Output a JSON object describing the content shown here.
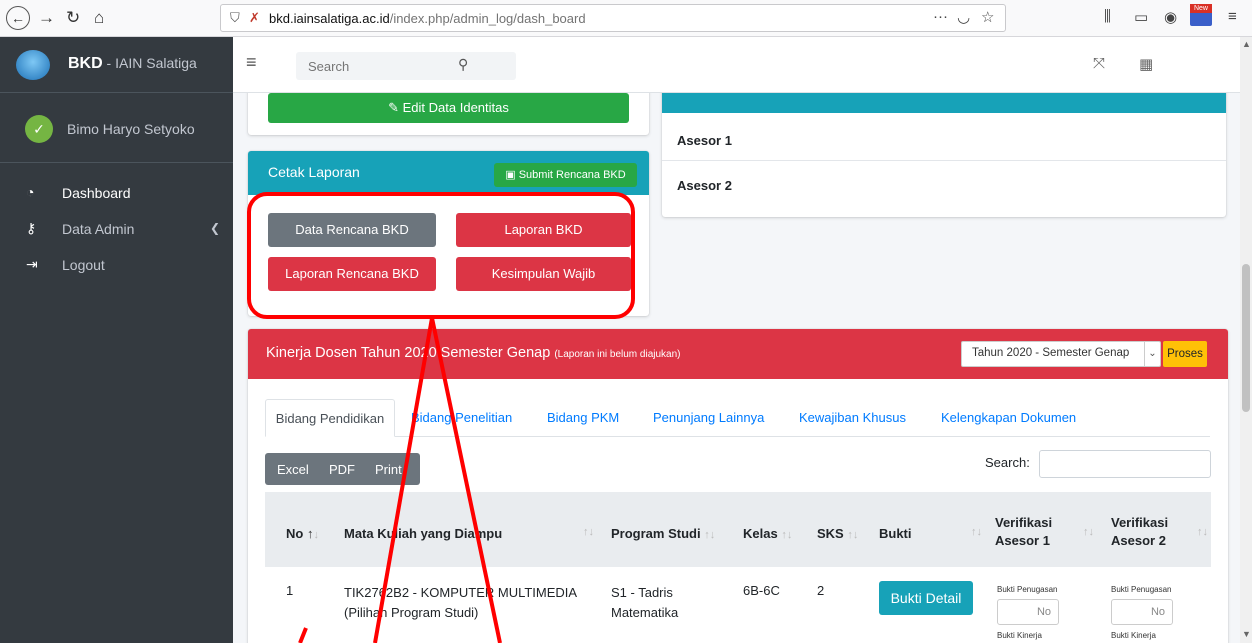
{
  "browser": {
    "url_domain": "bkd.iainsalatiga.ac.id",
    "url_path": "/index.php/admin_log/dash_board",
    "new_badge": "New"
  },
  "sidebar": {
    "brand_bold": "BKD",
    "brand_rest": " - IAIN Salatiga",
    "user_name": "Bimo Haryo Setyoko",
    "items": [
      {
        "label": "Dashboard",
        "icon": "dashboard-icon"
      },
      {
        "label": "Data Admin",
        "icon": "key-icon"
      },
      {
        "label": "Logout",
        "icon": "logout-icon"
      }
    ]
  },
  "topbar": {
    "search_placeholder": "Search"
  },
  "identity_card": {
    "edit_button": "Edit Data Identitas"
  },
  "asesor_card": {
    "asesor1": "Asesor 1",
    "asesor2": "Asesor 2"
  },
  "cetak": {
    "title": "Cetak Laporan",
    "submit_button": "Submit Rencana BKD",
    "buttons": [
      "Data Rencana BKD",
      "Laporan BKD",
      "Laporan Rencana BKD",
      "Kesimpulan Wajib"
    ]
  },
  "kinerja": {
    "title": "Kinerja Dosen  Tahun 2020 Semester Genap",
    "note": "(Laporan ini belum diajukan)",
    "period_select": "Tahun 2020 - Semester Genap",
    "proses_button": "Proses",
    "tabs": [
      "Bidang Pendidikan",
      "Bidang Penelitian",
      "Bidang PKM",
      "Penunjang Lainnya",
      "Kewajiban Khusus",
      "Kelengkapan Dokumen"
    ],
    "export_buttons": [
      "Excel",
      "PDF",
      "Print"
    ],
    "search_label": "Search:",
    "columns": [
      "No",
      "Mata Kuliah yang Diampu",
      "Program Studi",
      "Kelas",
      "SKS",
      "Bukti",
      "Verifikasi Asesor 1",
      "Verifikasi Asesor 2"
    ],
    "rows": [
      {
        "no": "1",
        "mk_line1": "TIK2762B2 - KOMPUTER MULTIMEDIA",
        "mk_line2": "(Pilihan Program Studi)",
        "prodi_line1": "S1 - Tadris",
        "prodi_line2": "Matematika",
        "kelas": "6B-6C",
        "sks": "2",
        "bukti_button": "Bukti Detail",
        "bukti_penugasan": "Bukti Penugasan",
        "bukti_kinerja": "Bukti Kinerja",
        "toggle_value": "No"
      }
    ]
  },
  "colors": {
    "sidebar": "#343a40",
    "info": "#17a2b8",
    "danger": "#dc3545",
    "success": "#28a745",
    "secondary": "#6c757d",
    "warning": "#ffc107",
    "annotation": "#ff0000"
  }
}
